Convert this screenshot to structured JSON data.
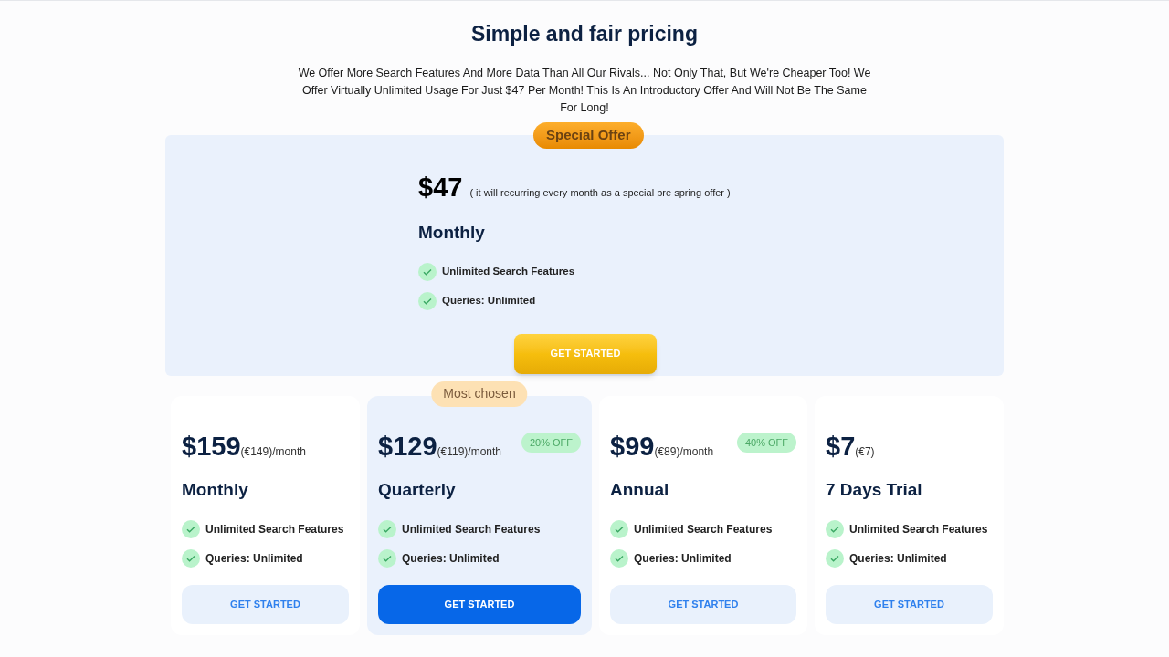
{
  "heading": "Simple and fair pricing",
  "intro": "We Offer More Search Features And More Data Than All Our Rivals... Not Only That, But We're Cheaper Too! We Offer Virtually Unlimited Usage For Just $47 Per Month! This Is An Introductory Offer And Will Not Be The Same For Long!",
  "special_offer": {
    "ribbon": "Special Offer",
    "price": "$47",
    "note": "( it will recurring every month as a special pre spring offer )",
    "period": "Monthly",
    "features": [
      "Unlimited Search Features",
      "Queries: Unlimited"
    ],
    "button": "GET STARTED"
  },
  "plans": [
    {
      "price": "$159",
      "suffix": "(€149)/month",
      "name": "Monthly",
      "featured": false,
      "features": [
        "Unlimited Search Features",
        "Queries: Unlimited"
      ],
      "button": "GET STARTED"
    },
    {
      "ribbon": "Most chosen",
      "price": "$129",
      "suffix": "(€119)/month",
      "discount": "20% OFF",
      "name": "Quarterly",
      "featured": true,
      "features": [
        "Unlimited Search Features",
        "Queries: Unlimited"
      ],
      "button": "GET STARTED"
    },
    {
      "price": "$99",
      "suffix": "(€89)/month",
      "discount": "40% OFF",
      "name": "Annual",
      "featured": false,
      "features": [
        "Unlimited Search Features",
        "Queries: Unlimited"
      ],
      "button": "GET STARTED"
    },
    {
      "price": "$7",
      "suffix": "(€7)",
      "name": "7 Days Trial",
      "featured": false,
      "features": [
        "Unlimited Search Features",
        "Queries: Unlimited"
      ],
      "button": "GET STARTED"
    }
  ]
}
